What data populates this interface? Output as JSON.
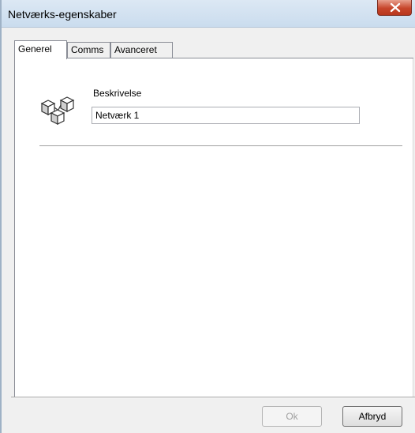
{
  "window": {
    "title": "Netværks-egenskaber"
  },
  "tabs": [
    {
      "label": "Generel",
      "active": true
    },
    {
      "label": "Comms",
      "active": false
    },
    {
      "label": "Avanceret",
      "active": false
    }
  ],
  "general": {
    "icon": "network-icon",
    "description_label": "Beskrivelse",
    "description_value": "Netværk 1"
  },
  "buttons": {
    "ok_label": "Ok",
    "ok_enabled": false,
    "cancel_label": "Afbryd"
  },
  "colors": {
    "close_button": "#c7462b",
    "titlebar": "#dce8f4"
  }
}
